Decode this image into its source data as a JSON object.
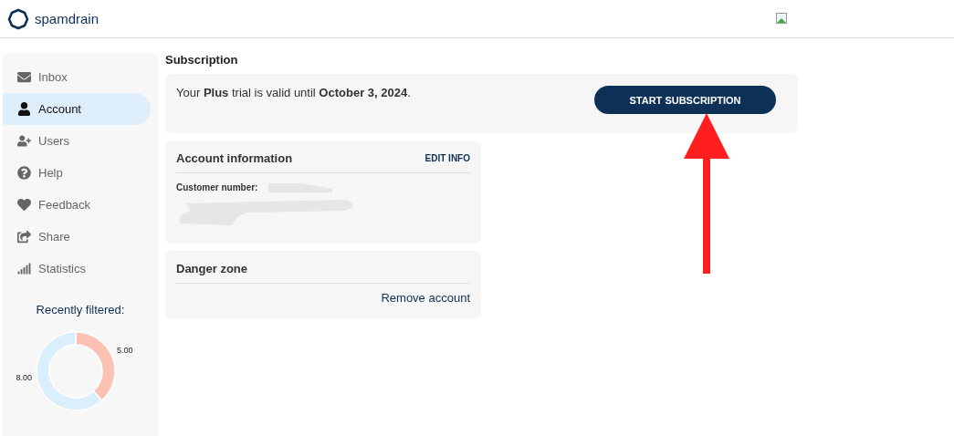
{
  "brand": {
    "name": "spamdrain"
  },
  "sidebar": {
    "items": [
      {
        "label": "Inbox",
        "selected": false
      },
      {
        "label": "Account",
        "selected": true
      },
      {
        "label": "Users",
        "selected": false
      },
      {
        "label": "Help",
        "selected": false
      },
      {
        "label": "Feedback",
        "selected": false
      },
      {
        "label": "Share",
        "selected": false
      },
      {
        "label": "Statistics",
        "selected": false
      }
    ],
    "recent": {
      "title": "Recently filtered:",
      "chart_data": {
        "type": "donut",
        "values": [
          5,
          8
        ],
        "value_labels": [
          "5.00",
          "8.00"
        ]
      }
    }
  },
  "subscription": {
    "heading": "Subscription",
    "message": "Your **Plus** trial is valid until **October 3, 2024**.",
    "button": "START SUBSCRIPTION"
  },
  "account_info": {
    "title": "Account information",
    "edit": "EDIT INFO",
    "customer_label": "Customer number:"
  },
  "danger_zone": {
    "title": "Danger zone",
    "action": "Remove account"
  }
}
